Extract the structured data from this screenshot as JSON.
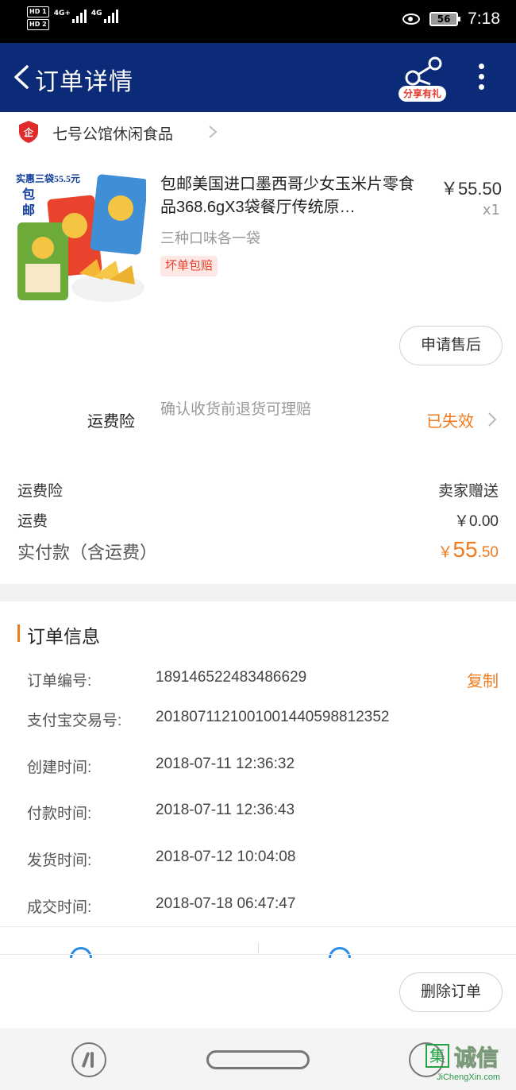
{
  "status_bar": {
    "hd1": "HD 1",
    "hd2": "HD 2",
    "net1": "4G+",
    "net2": "4G",
    "battery": "56",
    "time": "7:18"
  },
  "header": {
    "title": "订单详情",
    "share_badge": "分享有礼",
    "bg_color": "#0b2a78"
  },
  "shop": {
    "name": "七号公馆休闲食品",
    "icon": "enterprise-shield-icon"
  },
  "product": {
    "image_promo": "实惠三袋55.5元",
    "image_free": "包邮",
    "title": "包邮美国进口墨西哥少女玉米片零食品368.6gX3袋餐厅传统原…",
    "price": "￥55.50",
    "qty": "x1",
    "sku": "三种口味各一袋",
    "tag": "坏单包赔"
  },
  "actions": {
    "after_sale": "申请售后",
    "delete_order": "删除订单"
  },
  "insurance": {
    "label": "运费险",
    "desc": "确认收货前退货可理赔",
    "status": "已失效"
  },
  "fees": {
    "insurance_label": "运费险",
    "insurance_value": "卖家赠送",
    "shipping_label": "运费",
    "shipping_value": "￥0.00",
    "paid_label": "实付款（含运费）",
    "paid_currency": "￥",
    "paid_int": "55",
    "paid_dec": ".50"
  },
  "order_info": {
    "title": "订单信息",
    "copy": "复制",
    "rows": [
      {
        "label": "订单编号:",
        "value": "189146522483486629"
      },
      {
        "label": "支付宝交易号:",
        "value": "2018071121001001440598812352"
      },
      {
        "label": "创建时间:",
        "value": "2018-07-11 12:36:32"
      },
      {
        "label": "付款时间:",
        "value": "2018-07-11 12:36:43"
      },
      {
        "label": "发货时间:",
        "value": "2018-07-12 10:04:08"
      },
      {
        "label": "成交时间:",
        "value": "2018-07-18 06:47:47"
      }
    ]
  },
  "watermark": {
    "box": "集",
    "name": "诚信",
    "url": "JiChengXin.com"
  },
  "colors": {
    "accent": "#f07a1c",
    "link_blue": "#2b8ae8"
  }
}
